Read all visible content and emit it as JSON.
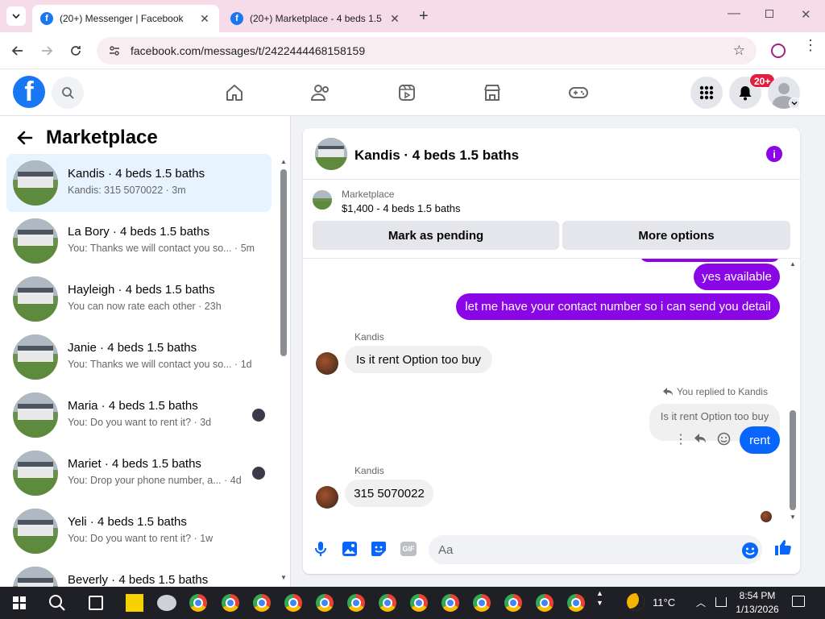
{
  "browser": {
    "tabs": [
      {
        "title": "(20+) Messenger | Facebook",
        "active": true
      },
      {
        "title": "(20+) Marketplace - 4 beds 1.5",
        "active": false
      }
    ],
    "url": "facebook.com/messages/t/2422444468158159"
  },
  "header": {
    "notification_badge": "20+"
  },
  "sidebar": {
    "title": "Marketplace",
    "conversations": [
      {
        "name": "Kandis · 4 beds 1.5 baths",
        "snippet": "Kandis: 315 5070022 · 3m",
        "selected": true
      },
      {
        "name": "La Bory · 4 beds 1.5 baths",
        "snippet": "You: Thanks we will contact you so... · 5m"
      },
      {
        "name": "Hayleigh · 4 beds 1.5 baths",
        "snippet": "You can now rate each other · 23h"
      },
      {
        "name": "Janie · 4 beds 1.5 baths",
        "snippet": "You: Thanks we will contact you so... · 1d"
      },
      {
        "name": "Maria · 4 beds 1.5 baths",
        "snippet": "You: Do you want to rent it? · 3d"
      },
      {
        "name": "Mariet · 4 beds 1.5 baths",
        "snippet": "You: Drop your phone number, a... · 4d"
      },
      {
        "name": "Yeli · 4 beds 1.5 baths",
        "snippet": "You: Do you want to rent it? · 1w"
      },
      {
        "name": "Beverly · 4 beds 1.5 baths",
        "snippet": ""
      }
    ]
  },
  "chat": {
    "title": "Kandis · 4 beds 1.5 baths",
    "listing": {
      "source": "Marketplace",
      "summary": "$1,400 - 4 beds 1.5 baths",
      "mark_pending": "Mark as pending",
      "more_options": "More options"
    },
    "messages": {
      "out1": "yes available",
      "out2": "let me have your contact number so i can send you detail",
      "sender1": "Kandis",
      "in1": "Is it rent Option too buy",
      "reply_note": "You replied to Kandis",
      "quoted": "Is it rent Option too buy",
      "out3": "rent",
      "sender2": "Kandis",
      "in2": "315 5070022"
    },
    "composer_placeholder": "Aa",
    "gif_label": "GIF"
  },
  "taskbar": {
    "weather": "11°C",
    "time": "8:54 PM",
    "date": "1/13/2026"
  },
  "colors": {
    "accent_purple": "#8a06e6",
    "messenger_blue": "#0866ff",
    "facebook_blue": "#1877f2",
    "notif_red": "#e41e3f"
  }
}
